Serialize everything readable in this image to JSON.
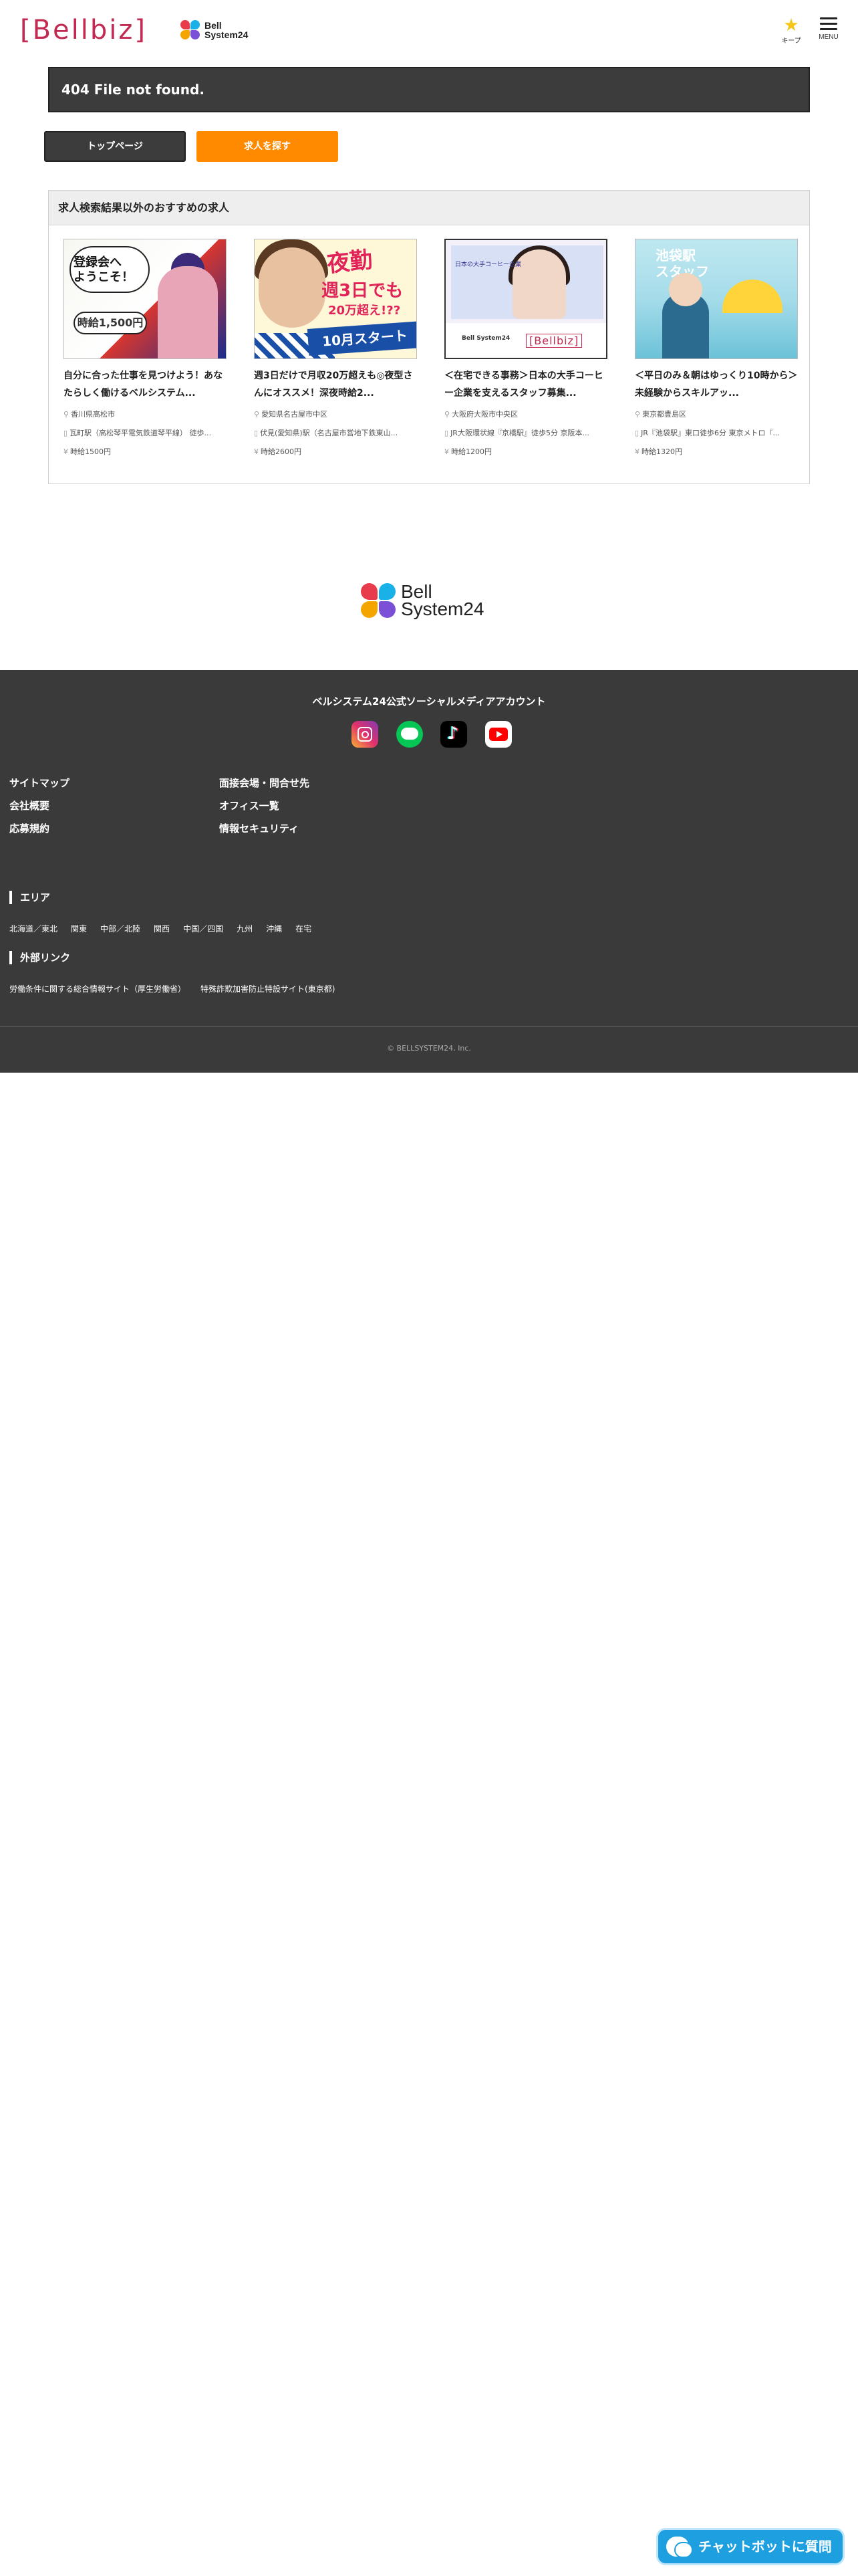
{
  "header": {
    "logo_text": "[Bellbiz]",
    "bs_logo_line1": "Bell",
    "bs_logo_line2": "System24",
    "keep_label": "キープ",
    "menu_label": "MENU"
  },
  "error": {
    "message": "404 File not found."
  },
  "buttons": {
    "top_page": "トップページ",
    "search_jobs": "求人を探す"
  },
  "recommend": {
    "heading": "求人検索結果以外のおすすめの求人",
    "cards": [
      {
        "title": "自分に合った仕事を見つけよう！あなたらしく働けるベルシステム...",
        "location": "香川県高松市",
        "station": "瓦町駅（高松琴平電気鉄道琴平線） 徒歩...",
        "wage": "時給1500円",
        "thumb_text1": "登録会へ",
        "thumb_text2": "ようこそ！",
        "thumb_wage": "時給1,500円"
      },
      {
        "title": "週3日だけで月収20万超えも◎夜型さんにオススメ！深夜時給2...",
        "location": "愛知県名古屋市中区",
        "station": "伏見(愛知県)駅（名古屋市営地下鉄東山...",
        "wage": "時給2600円",
        "thumb_text1": "夜勤",
        "thumb_text2": "週3日でも",
        "thumb_text3": "20万超え!??",
        "thumb_band": "10月スタート"
      },
      {
        "title": "＜在宅できる事務＞日本の大手コーヒー企業を支えるスタッフ募集...",
        "location": "大阪府大阪市中央区",
        "station": "JR大阪環状線『京橋駅』徒歩5分 京阪本...",
        "wage": "時給1200円",
        "thumb_text1": "日本の大手コーヒー企業",
        "thumb_logo": "[Bellbiz]"
      },
      {
        "title": "＜平日のみ＆朝はゆっくり10時から＞未経験からスキルアッ...",
        "location": "東京都豊島区",
        "station": "JR『池袋駅』東口徒歩6分 東京メトロ『...",
        "wage": "時給1320円",
        "thumb_text1": "池袋駅",
        "thumb_text2": "スタッフ"
      }
    ]
  },
  "footer": {
    "sns_title": "ベルシステム24公式ソーシャルメディアアカウント",
    "links_col1": [
      "サイトマップ",
      "会社概要",
      "応募規約"
    ],
    "links_col2": [
      "面接会場・問合せ先",
      "オフィス一覧",
      "情報セキュリティ"
    ],
    "area_title": "エリア",
    "areas": [
      "北海道／東北",
      "関東",
      "中部／北陸",
      "関西",
      "中国／四国",
      "九州",
      "沖縄",
      "在宅"
    ],
    "ext_title": "外部リンク",
    "ext_links": [
      "労働条件に関する総合情報サイト（厚生労働省）",
      "特殊詐欺加害防止特設サイト(東京都)"
    ],
    "copyright": "© BELLSYSTEM24, Inc."
  },
  "chatbot": {
    "label": "チャットボットに質問"
  }
}
